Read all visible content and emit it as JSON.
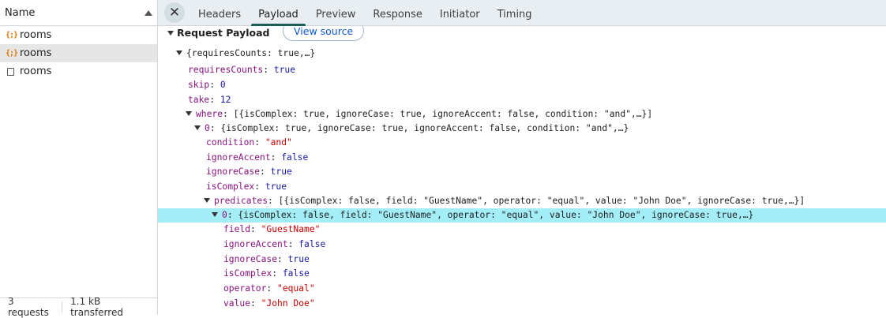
{
  "left": {
    "column_header": "Name",
    "requests": [
      {
        "name": "rooms",
        "icon": "json-icon"
      },
      {
        "name": "rooms",
        "icon": "json-icon"
      },
      {
        "name": "rooms",
        "icon": "document-icon"
      }
    ],
    "status": {
      "requests": "3 requests",
      "transferred": "1.1 kB transferred"
    }
  },
  "tabs": {
    "close": "✕",
    "items": [
      "Headers",
      "Payload",
      "Preview",
      "Response",
      "Initiator",
      "Timing"
    ],
    "active": "Payload"
  },
  "payload": {
    "section_title": "Request Payload",
    "view_source": "View source",
    "root_summary": "{requiresCounts: true,…}",
    "requiresCounts": {
      "key": "requiresCounts",
      "value": "true"
    },
    "skip": {
      "key": "skip",
      "value": "0"
    },
    "take": {
      "key": "take",
      "value": "12"
    },
    "where": {
      "key": "where",
      "summary": "[{isComplex: true, ignoreCase: true, ignoreAccent: false, condition: \"and\",…}]"
    },
    "where0": {
      "key": "0",
      "summary": "{isComplex: true, ignoreCase: true, ignoreAccent: false, condition: \"and\",…}"
    },
    "condition": {
      "key": "condition",
      "value": "\"and\""
    },
    "ignoreAccent": {
      "key": "ignoreAccent",
      "value": "false"
    },
    "ignoreCase": {
      "key": "ignoreCase",
      "value": "true"
    },
    "isComplex": {
      "key": "isComplex",
      "value": "true"
    },
    "predicates": {
      "key": "predicates",
      "summary": "[{isComplex: false, field: \"GuestName\", operator: \"equal\", value: \"John Doe\", ignoreCase: true,…}]"
    },
    "pred0": {
      "key": "0",
      "summary": "{isComplex: false, field: \"GuestName\", operator: \"equal\", value: \"John Doe\", ignoreCase: true,…}"
    },
    "field": {
      "key": "field",
      "value": "\"GuestName\""
    },
    "p_ignoreAccent": {
      "key": "ignoreAccent",
      "value": "false"
    },
    "p_ignoreCase": {
      "key": "ignoreCase",
      "value": "true"
    },
    "p_isComplex": {
      "key": "isComplex",
      "value": "false"
    },
    "operator": {
      "key": "operator",
      "value": "\"equal\""
    },
    "value": {
      "key": "value",
      "value": "\"John Doe\""
    }
  }
}
